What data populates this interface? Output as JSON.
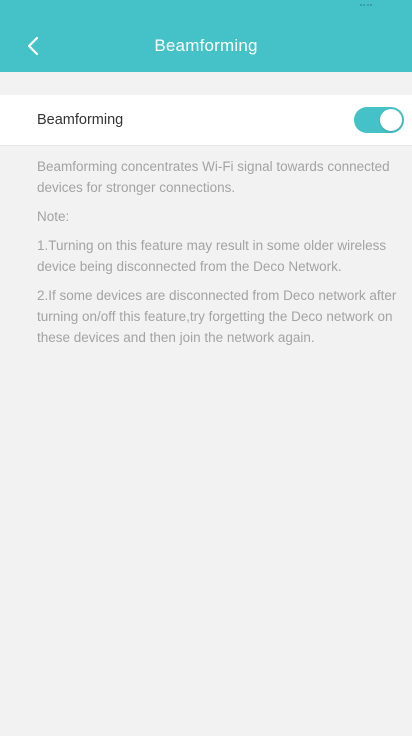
{
  "header": {
    "title": "Beamforming",
    "back_icon": "chevron-left-icon"
  },
  "setting": {
    "label": "Beamforming",
    "enabled": true,
    "accent_color": "#45c1c8"
  },
  "info": {
    "description": "Beamforming concentrates Wi-Fi signal towards connected devices for stronger connections.",
    "note_heading": "Note:",
    "note_1": "1.Turning on this feature may result in some older wireless device being disconnected from the Deco Network.",
    "note_2": "2.If some devices are disconnected from Deco network after turning on/off this feature,try forgetting the Deco network on these devices and then join the network again."
  }
}
